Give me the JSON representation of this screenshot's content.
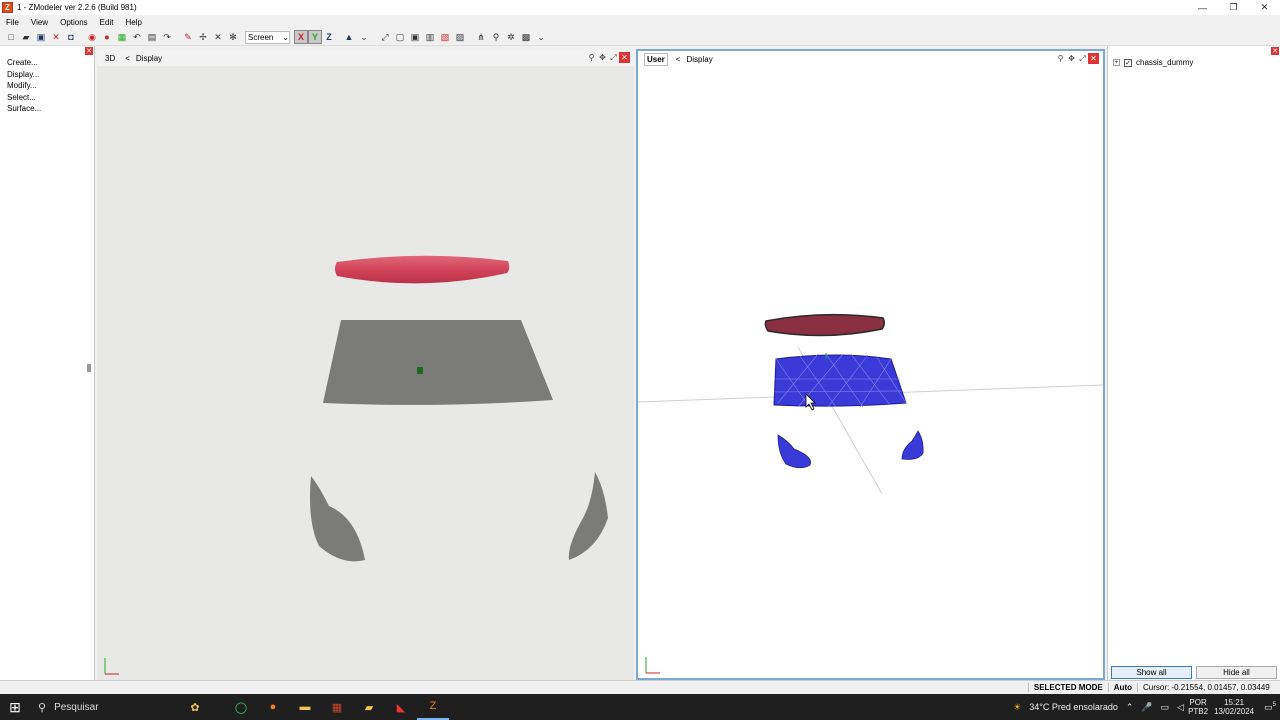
{
  "window": {
    "title": "1 - ZModeler ver 2.2.6 (Build 981)",
    "app_icon": "Z",
    "minimize": "—",
    "restore": "❐",
    "close": "✕"
  },
  "menu": {
    "file": "File",
    "view": "View",
    "options": "Options",
    "edit": "Edit",
    "help": "Help"
  },
  "toolbar": {
    "screen_combo": "Screen",
    "axis_x": "X",
    "axis_y": "Y",
    "axis_z": "Z"
  },
  "commands": [
    "Create...",
    "Display...",
    "Modify...",
    "Select...",
    "Surface..."
  ],
  "viewport_left": {
    "mode": "3D",
    "label": "Display"
  },
  "viewport_right": {
    "mode": "User",
    "label": "Display"
  },
  "scene": {
    "item": "chassis_dummy",
    "show_all": "Show all",
    "hide_all": "Hide all"
  },
  "status": {
    "mode": "SELECTED MODE",
    "auto": "Auto",
    "cursor": "Cursor: -0.21554, 0.01457, 0.03449"
  },
  "taskbar": {
    "search": "Pesquisar",
    "weather": "34°C  Pred ensolarado",
    "lang_top": "POR",
    "lang_bottom": "PTB2",
    "time": "15:21",
    "date": "13/02/2024",
    "notif": "5"
  },
  "colors": {
    "selection_blue": "#3a3ad8",
    "bumper_red": "#d4445a",
    "grey_mesh": "#7b7c79",
    "active_border": "#7aa9d6"
  }
}
